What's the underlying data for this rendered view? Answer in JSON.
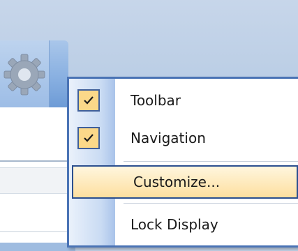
{
  "menu": {
    "items": [
      {
        "label": "Toolbar",
        "checked": true
      },
      {
        "label": "Navigation",
        "checked": true
      },
      {
        "label": "Customize...",
        "checked": false,
        "highlighted": true
      },
      {
        "label": "Lock Display",
        "checked": false
      }
    ]
  },
  "colors": {
    "menu_border": "#4a73b5",
    "highlight_fill": "#fddf9f",
    "check_fill": "#fbd889",
    "background": "#c6d6ea"
  },
  "icons": {
    "toolbar_button": "gear-icon",
    "dropdown": "dropdown-arrow-icon",
    "check": "checkmark-icon"
  }
}
